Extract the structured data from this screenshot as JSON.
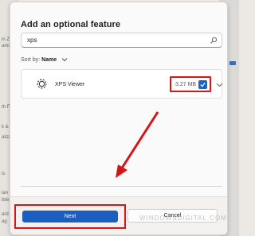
{
  "dialog": {
    "title": "Add an optional feature",
    "search": {
      "value": "xps"
    },
    "sort": {
      "label": "Sort by:",
      "value": "Name"
    },
    "feature": {
      "name": "XPS Viewer",
      "size": "3.27 MB",
      "checked": true
    },
    "buttons": {
      "next": "Next",
      "cancel": "Cancel"
    }
  },
  "background": {
    "fragments": [
      "in Z",
      "amo",
      "th F",
      "k &",
      "aliza",
      "ts",
      "lan",
      "ible",
      "ard",
      "ag"
    ]
  },
  "watermark": "WINDOWSDIGITAL.COM",
  "colors": {
    "accent": "#1a5fc0",
    "highlight": "#e11212"
  }
}
